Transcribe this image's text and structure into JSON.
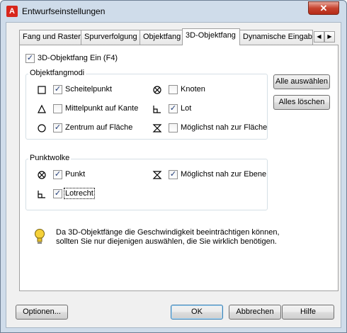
{
  "window": {
    "title": "Entwurfseinstellungen",
    "app_icon_letter": "A",
    "close_glyph": "✕"
  },
  "tabs": [
    {
      "label": "Fang und Raster"
    },
    {
      "label": "Spurverfolgung"
    },
    {
      "label": "Objektfang"
    },
    {
      "label": "3D-Objektfang",
      "active": true
    },
    {
      "label": "Dynamische Eingabe"
    }
  ],
  "tab_scroll": {
    "left": "◀",
    "right": "▶"
  },
  "osnap3d": {
    "enable_label": "3D-Objektfang Ein (F4)",
    "enable_checked": true,
    "modes_group": {
      "title": "Objektfangmodi",
      "items": [
        {
          "label": "Scheitelpunkt",
          "checked": true,
          "icon": "square-marker-icon"
        },
        {
          "label": "Mittelpunkt auf Kante",
          "checked": false,
          "icon": "triangle-marker-icon"
        },
        {
          "label": "Zentrum auf Fläche",
          "checked": true,
          "icon": "circle-marker-icon"
        },
        {
          "label": "Knoten",
          "checked": false,
          "icon": "node-marker-icon"
        },
        {
          "label": "Lot",
          "checked": true,
          "icon": "perpendicular-marker-icon"
        },
        {
          "label": "Möglichst nah zur Fläche",
          "checked": false,
          "icon": "nearest-marker-icon"
        }
      ]
    },
    "select_all_label": "Alle auswählen",
    "clear_all_label": "Alles löschen",
    "pointcloud_group": {
      "title": "Punktwolke",
      "items": [
        {
          "label": "Punkt",
          "checked": true,
          "icon": "node-marker-icon"
        },
        {
          "label": "Lotrecht",
          "checked": true,
          "icon": "perpendicular-marker-icon"
        },
        {
          "label": "Möglichst nah zur Ebene",
          "checked": true,
          "icon": "nearest-marker-icon"
        }
      ]
    },
    "info_text_1": "Da 3D-Objektfänge die Geschwindigkeit beeinträchtigen können,",
    "info_text_2": "sollten Sie nur diejenigen auswählen, die Sie wirklich benötigen."
  },
  "footer": {
    "options_label": "Optionen...",
    "ok_label": "OK",
    "cancel_label": "Abbrechen",
    "help_label": "Hilfe"
  },
  "colors": {
    "frame": "#cfdcea",
    "close": "#c7432f",
    "check": "#1f3b78",
    "bulb": "#f5d13a"
  }
}
